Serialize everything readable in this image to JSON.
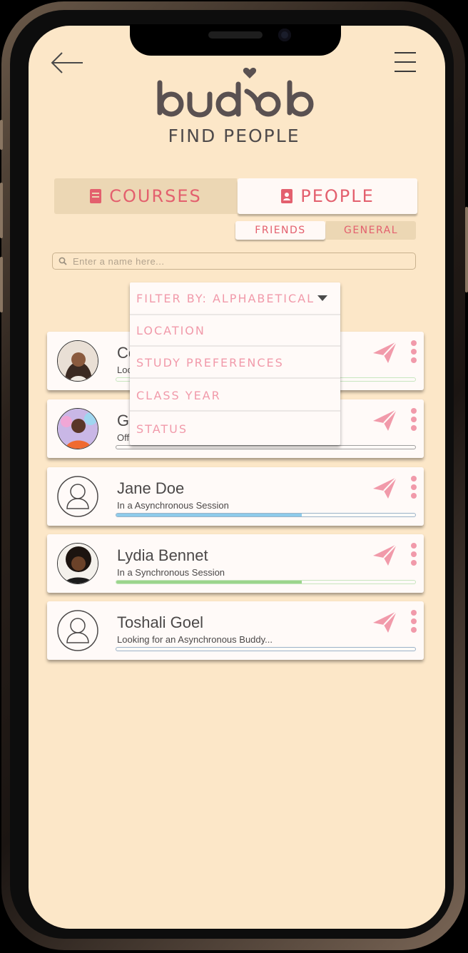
{
  "header": {
    "logo_text": "buddy",
    "title": "FIND PEOPLE"
  },
  "tabs": {
    "courses_label": "COURSES",
    "people_label": "PEOPLE",
    "friends_label": "FRIENDS",
    "general_label": "GENERAL"
  },
  "search": {
    "placeholder": "Enter a name here..."
  },
  "filter": {
    "label": "FILTER BY: ALPHABETICAL",
    "options": [
      "LOCATION",
      "STUDY PREFERENCES",
      "CLASS YEAR",
      "STATUS"
    ]
  },
  "people": [
    {
      "name": "Co",
      "status": "Loo",
      "avatar": "photo-woman-1",
      "progress": 0.0,
      "bar_color": "#c7e6bf"
    },
    {
      "name": "Gi",
      "status": "Off",
      "avatar": "photo-woman-2",
      "progress": 0.0,
      "bar_color": "#e7e7e7"
    },
    {
      "name": "Jane Doe",
      "status": "In a Asynchronous Session",
      "avatar": "placeholder-user-icon",
      "progress": 0.62,
      "bar_color": "#8ecbea"
    },
    {
      "name": "Lydia Bennet",
      "status": "In a Synchronous Session",
      "avatar": "photo-woman-3",
      "progress": 0.62,
      "bar_color": "#9bd58c"
    },
    {
      "name": "Toshali Goel",
      "status": "Looking for an Asynchronous Buddy...",
      "avatar": "placeholder-user-icon",
      "progress": 0.0,
      "bar_color": "#8ecbea"
    }
  ],
  "colors": {
    "background": "#fce7c8",
    "accent": "#e3606e",
    "accent_light": "#f19aaa",
    "tab_inactive": "#ecd7b4",
    "card": "#fffaf8",
    "text": "#4b4848"
  }
}
